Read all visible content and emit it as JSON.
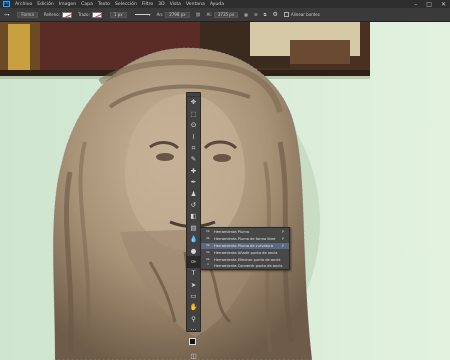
{
  "app": {
    "logo": "Ps"
  },
  "menubar": {
    "items": [
      "Archivo",
      "Edición",
      "Imagen",
      "Capa",
      "Texto",
      "Selección",
      "Filtro",
      "3D",
      "Vista",
      "Ventana",
      "Ayuda"
    ],
    "win_minimize": "–",
    "win_maximize": "□",
    "win_close": "✕"
  },
  "options": {
    "tool_icon": "pen-tool-icon",
    "mode_value": "Forma",
    "fill_label": "Relleno:",
    "stroke_label": "Trazo:",
    "stroke_width": "1 px",
    "width_label": "An:",
    "width_value": "2798 px",
    "height_label": "Al:",
    "height_value": "3735 px",
    "align_edges_label": "Alinear bordes"
  },
  "toolbar": {
    "tools": [
      {
        "name": "move-tool-icon",
        "glyph": "✥"
      },
      {
        "name": "marquee-tool-icon",
        "glyph": "⬚"
      },
      {
        "name": "lasso-tool-icon",
        "glyph": "ʘ"
      },
      {
        "name": "quick-selection-tool-icon",
        "glyph": "⌇"
      },
      {
        "name": "crop-tool-icon",
        "glyph": "⌗"
      },
      {
        "name": "eyedropper-tool-icon",
        "glyph": "✎"
      },
      {
        "name": "healing-brush-tool-icon",
        "glyph": "✚"
      },
      {
        "name": "brush-tool-icon",
        "glyph": "✒"
      },
      {
        "name": "clone-stamp-tool-icon",
        "glyph": "♟"
      },
      {
        "name": "history-brush-tool-icon",
        "glyph": "↺"
      },
      {
        "name": "eraser-tool-icon",
        "glyph": "◧"
      },
      {
        "name": "gradient-tool-icon",
        "glyph": "▤"
      },
      {
        "name": "blur-tool-icon",
        "glyph": "💧"
      },
      {
        "name": "dodge-tool-icon",
        "glyph": "●"
      },
      {
        "name": "pen-tool-icon",
        "glyph": "✑"
      },
      {
        "name": "type-tool-icon",
        "glyph": "T"
      },
      {
        "name": "path-selection-tool-icon",
        "glyph": "➤"
      },
      {
        "name": "rectangle-tool-icon",
        "glyph": "▭"
      },
      {
        "name": "hand-tool-icon",
        "glyph": "✋"
      },
      {
        "name": "zoom-tool-icon",
        "glyph": "⚲"
      },
      {
        "name": "more-tools-icon",
        "glyph": "···"
      }
    ],
    "bottom_tools": [
      {
        "name": "quick-mask-icon",
        "glyph": "◫"
      },
      {
        "name": "screen-mode-icon",
        "glyph": "▣"
      }
    ]
  },
  "flyout": {
    "items": [
      {
        "icon": "pen-icon",
        "glyph": "✑",
        "label": "Herramienta Pluma",
        "shortcut": "P"
      },
      {
        "icon": "freeform-pen-icon",
        "glyph": "✑",
        "label": "Herramienta Pluma de forma libre",
        "shortcut": "P"
      },
      {
        "icon": "curvature-pen-icon",
        "glyph": "✑",
        "label": "Herramienta Pluma de curvatura",
        "shortcut": "P"
      },
      {
        "icon": "add-anchor-point-icon",
        "glyph": "✑",
        "label": "Herramienta Añadir punto de ancla",
        "shortcut": ""
      },
      {
        "icon": "delete-anchor-point-icon",
        "glyph": "✑",
        "label": "Herramienta Eliminar punto de ancla",
        "shortcut": ""
      },
      {
        "icon": "convert-point-icon",
        "glyph": "⌃",
        "label": "Herramienta Convertir punto de ancla",
        "shortcut": ""
      }
    ],
    "selected_index": 2
  },
  "colors": {
    "accent": "#31a8ff",
    "wall": "#d8ecd6",
    "stone": "#b19d83"
  }
}
